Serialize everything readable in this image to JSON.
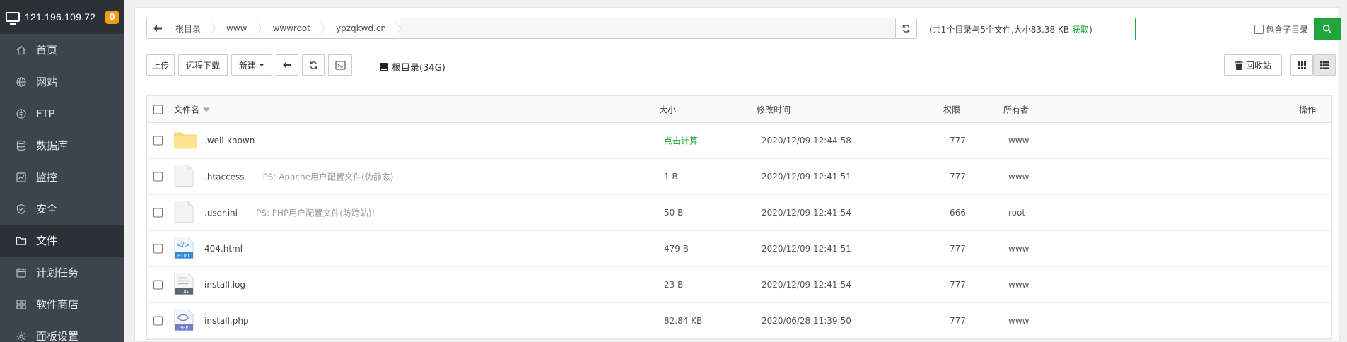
{
  "sidebar": {
    "ip": "121.196.109.72",
    "badge": "0",
    "items": [
      {
        "label": "首页",
        "icon": "home-icon"
      },
      {
        "label": "网站",
        "icon": "globe-icon"
      },
      {
        "label": "FTP",
        "icon": "ftp-icon"
      },
      {
        "label": "数据库",
        "icon": "database-icon"
      },
      {
        "label": "监控",
        "icon": "monitor-icon"
      },
      {
        "label": "安全",
        "icon": "shield-icon"
      },
      {
        "label": "文件",
        "icon": "folder-icon",
        "active": true
      },
      {
        "label": "计划任务",
        "icon": "calendar-icon"
      },
      {
        "label": "软件商店",
        "icon": "grid-icon"
      },
      {
        "label": "面板设置",
        "icon": "gear-icon"
      }
    ]
  },
  "path": {
    "crumbs": [
      "根目录",
      "www",
      "wwwroot",
      "ypzqkwd.cn"
    ],
    "info": "(共1个目录与5个文件,大小83.38 KB",
    "info_action": "获取",
    "info_close": ")"
  },
  "search": {
    "placeholder": "",
    "include_sub_label": "包含子目录"
  },
  "toolbar": {
    "upload": "上传",
    "remote_download": "远程下载",
    "new": "新建",
    "disk": "根目录(34G)",
    "recycle": "回收站"
  },
  "table": {
    "headers": {
      "name": "文件名",
      "size": "大小",
      "mtime": "修改时间",
      "perm": "权限",
      "owner": "所有者",
      "ops": "操作"
    },
    "rows": [
      {
        "name": ".well-known",
        "ps": "",
        "size": "点击计算",
        "mtime": "2020/12/09 12:44:58",
        "perm": "777",
        "owner": "www",
        "type": "folder"
      },
      {
        "name": ".htaccess",
        "ps": "PS: Apache用户配置文件(伪静态)",
        "size": "1 B",
        "mtime": "2020/12/09 12:41:51",
        "perm": "777",
        "owner": "www",
        "type": "file"
      },
      {
        "name": ".user.ini",
        "ps": "PS: PHP用户配置文件(防跨站)!",
        "size": "50 B",
        "mtime": "2020/12/09 12:41:54",
        "perm": "666",
        "owner": "root",
        "type": "file"
      },
      {
        "name": "404.html",
        "ps": "",
        "size": "479 B",
        "mtime": "2020/12/09 12:41:51",
        "perm": "777",
        "owner": "www",
        "type": "html",
        "tag": "HTML"
      },
      {
        "name": "install.log",
        "ps": "",
        "size": "23 B",
        "mtime": "2020/12/09 12:41:54",
        "perm": "777",
        "owner": "www",
        "type": "log",
        "tag": "LOG"
      },
      {
        "name": "install.php",
        "ps": "",
        "size": "82.84 KB",
        "mtime": "2020/06/28 11:39:50",
        "perm": "777",
        "owner": "www",
        "type": "php",
        "tag": "PHP"
      }
    ]
  },
  "colors": {
    "accent": "#20a53a",
    "sidebar_bg": "#3c444d",
    "sidebar_active": "#2c3138",
    "badge": "#f39c12"
  }
}
